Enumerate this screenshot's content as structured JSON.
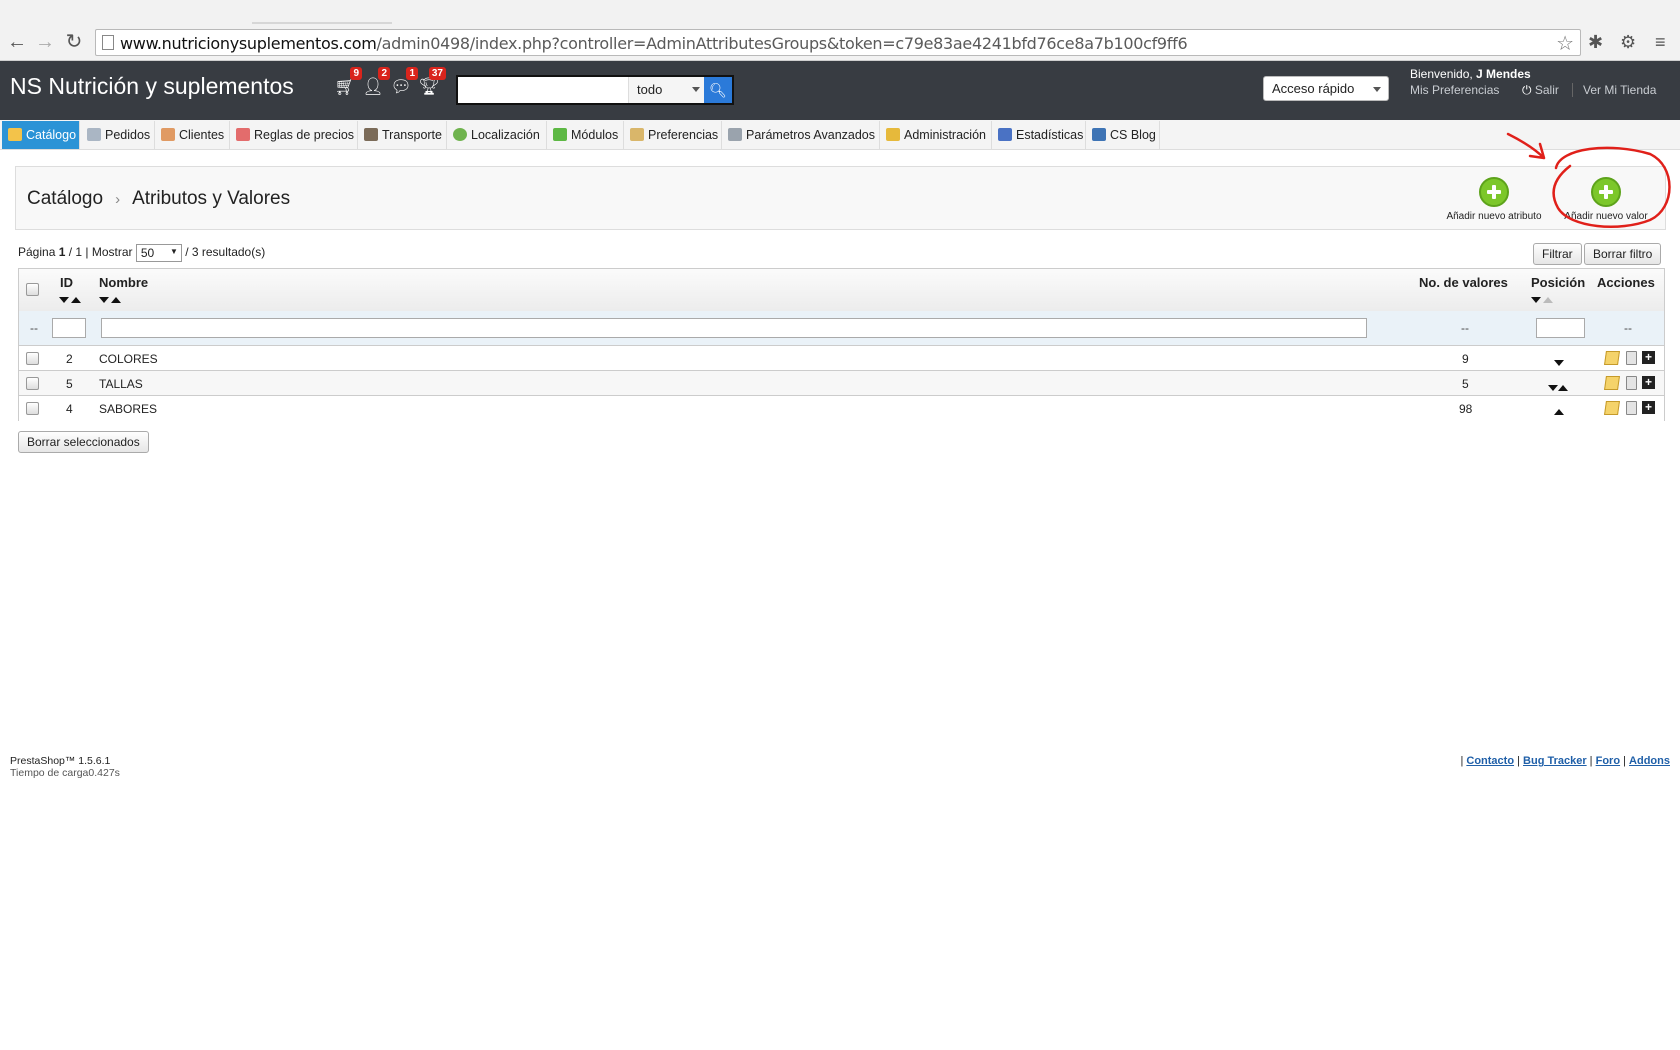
{
  "browser": {
    "url_host": "www.nutricionysuplementos.com",
    "url_path": "/admin0498/index.php?controller=AdminAttributesGroups&token=c79e83ae4241bfd76ce8a7b100cf9ff6"
  },
  "header": {
    "shop_title": "NS Nutrición y suplementos",
    "notifications": [
      {
        "icon": "cart-icon",
        "count": "9"
      },
      {
        "icon": "customer-icon",
        "count": "2"
      },
      {
        "icon": "message-icon",
        "count": "1"
      },
      {
        "icon": "trophy-icon",
        "count": "37"
      }
    ],
    "search_scope": "todo",
    "quick_access": "Acceso rápido",
    "welcome_prefix": "Bienvenido, ",
    "user_name": "J Mendes",
    "my_prefs": "Mis Preferencias",
    "logout": "Salir",
    "view_store": "Ver Mi Tienda"
  },
  "menu": [
    {
      "label": "Catálogo",
      "active": true
    },
    {
      "label": "Pedidos"
    },
    {
      "label": "Clientes"
    },
    {
      "label": "Reglas de precios"
    },
    {
      "label": "Transporte"
    },
    {
      "label": "Localización"
    },
    {
      "label": "Módulos"
    },
    {
      "label": "Preferencias"
    },
    {
      "label": "Parámetros Avanzados"
    },
    {
      "label": "Administración"
    },
    {
      "label": "Estadísticas"
    },
    {
      "label": "CS Blog"
    }
  ],
  "toolbar": {
    "breadcrumb_root": "Catálogo",
    "breadcrumb_current": "Atributos y Valores",
    "add_attribute": "Añadir nuevo atributo",
    "add_value": "Añadir nuevo valor"
  },
  "pager": {
    "page_label": "Página ",
    "page": "1",
    "of": " / 1 | Mostrar ",
    "per_page": "50",
    "results": " / 3 resultado(s)",
    "filter_btn": "Filtrar",
    "clear_filter_btn": "Borrar filtro"
  },
  "table": {
    "headers": {
      "id": "ID",
      "name": "Nombre",
      "count": "No. de valores",
      "position": "Posición",
      "actions": "Acciones"
    },
    "filter_dash": "--",
    "rows": [
      {
        "id": "2",
        "name": "COLORES",
        "count": "9"
      },
      {
        "id": "5",
        "name": "TALLAS",
        "count": "5"
      },
      {
        "id": "4",
        "name": "SABORES",
        "count": "98"
      }
    ]
  },
  "bulk_delete": "Borrar seleccionados",
  "footer": {
    "version": "PrestaShop™ 1.5.6.1",
    "load_time": "Tiempo de carga0.427s",
    "links": [
      "Contacto",
      "Bug Tracker",
      "Foro",
      "Addons"
    ]
  }
}
